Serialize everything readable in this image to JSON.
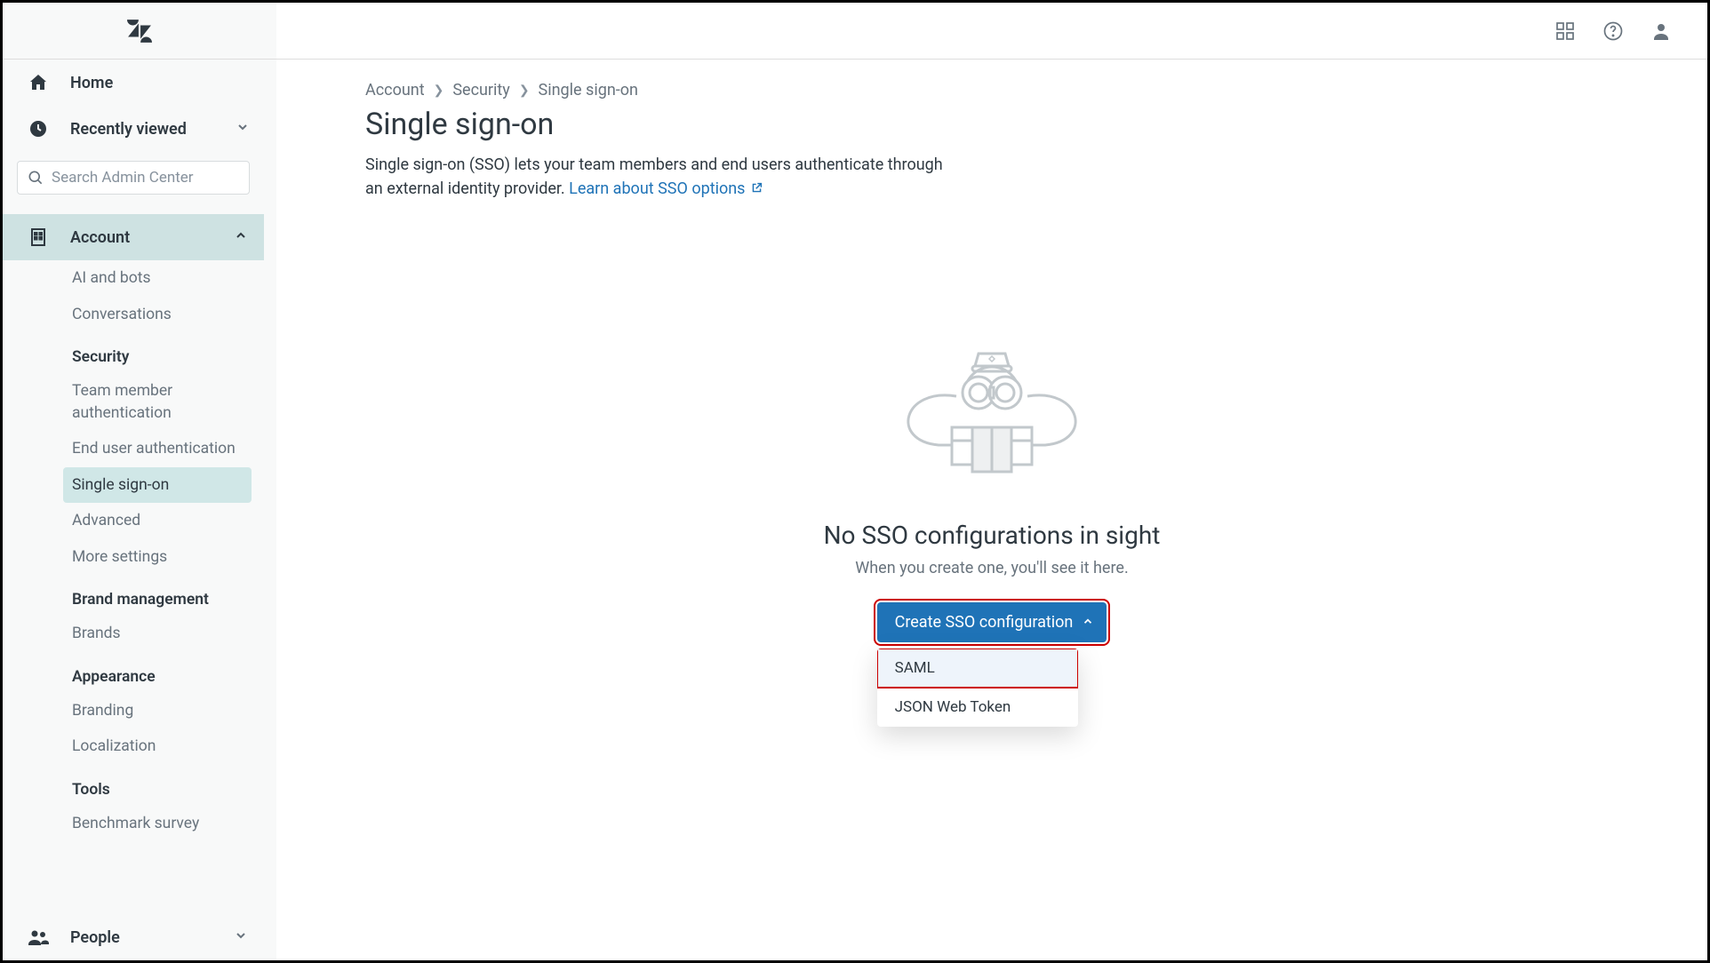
{
  "header": {
    "logo_alt": "Zendesk"
  },
  "sidebar": {
    "home_label": "Home",
    "recent_label": "Recently viewed",
    "search_placeholder": "Search Admin Center",
    "account_label": "Account",
    "sub": {
      "ai_bots": "AI and bots",
      "conversations": "Conversations",
      "security_heading": "Security",
      "team_member_auth": "Team member authentication",
      "end_user_auth": "End user authentication",
      "sso": "Single sign-on",
      "advanced": "Advanced",
      "more_settings": "More settings",
      "brand_mgmt_heading": "Brand management",
      "brands": "Brands",
      "appearance_heading": "Appearance",
      "branding": "Branding",
      "localization": "Localization",
      "tools_heading": "Tools",
      "benchmark": "Benchmark survey"
    },
    "people_label": "People"
  },
  "breadcrumb": {
    "account": "Account",
    "security": "Security",
    "current": "Single sign-on"
  },
  "page": {
    "title": "Single sign-on",
    "description_1": "Single sign-on (SSO) lets your team members and end users authenticate through an external identity provider. ",
    "learn_link": "Learn about SSO options"
  },
  "empty": {
    "title": "No SSO configurations in sight",
    "subtitle": "When you create one, you'll see it here.",
    "button": "Create SSO configuration",
    "option_saml": "SAML",
    "option_jwt": "JSON Web Token"
  }
}
